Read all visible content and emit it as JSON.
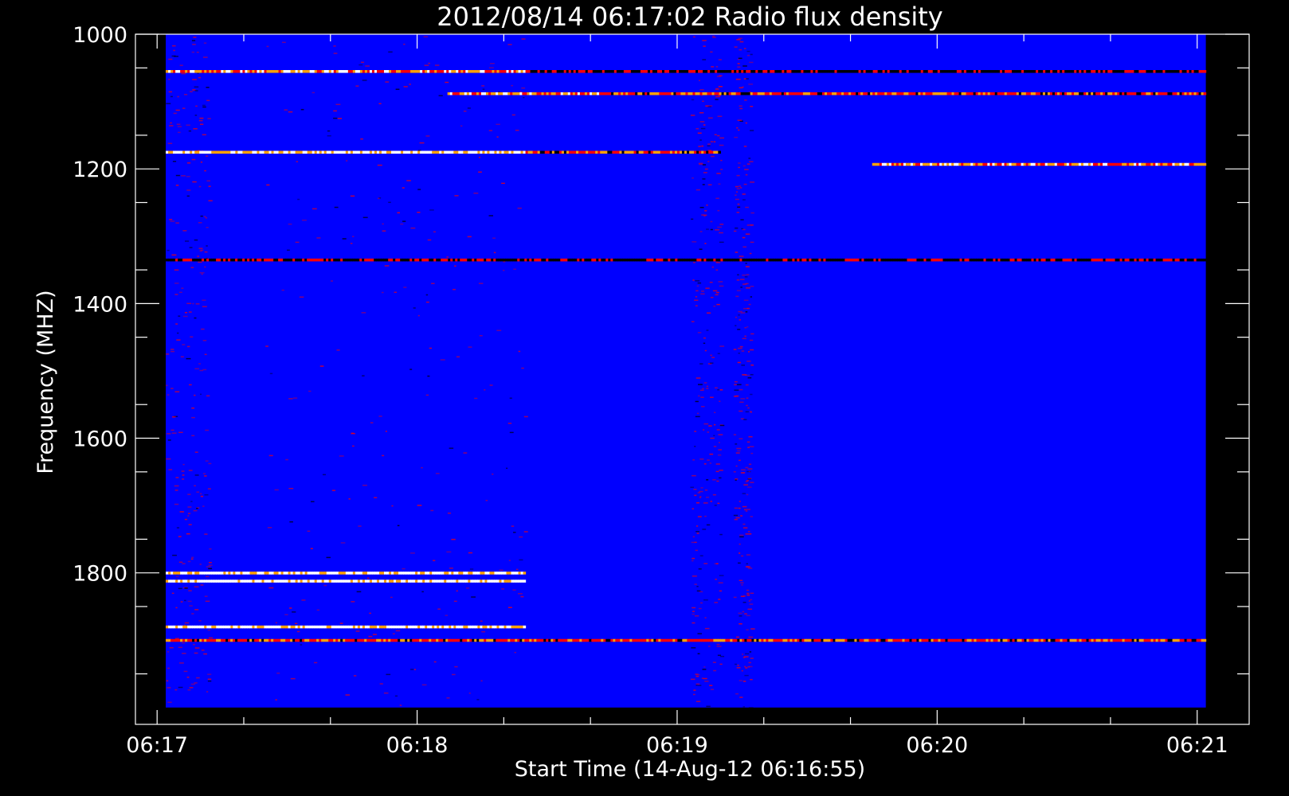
{
  "chart_data": {
    "type": "heatmap",
    "title": "2012/08/14 06:17:02 Radio flux density",
    "xlabel": "Start Time (14-Aug-12 06:16:55)",
    "ylabel": "Frequency (MHZ)",
    "x_ticks": [
      "06:17",
      "06:18",
      "06:19",
      "06:20",
      "06:21"
    ],
    "y_ticks": [
      "1000",
      "1200",
      "1400",
      "1600",
      "1800"
    ],
    "xlim": [
      "06:16:55",
      "06:21:12"
    ],
    "ylim": [
      1000,
      2025
    ],
    "y_axis_inverted": true,
    "data_extent": {
      "time_start": "06:17:02",
      "time_end": "06:21:02",
      "freq_start": 1000,
      "freq_end": 2000
    },
    "colormap": [
      "#000000",
      "#0000ff",
      "#ff0000",
      "#ffa000",
      "#ffffff"
    ],
    "background_color": "#0000ff",
    "active_periods": [
      {
        "start": "06:17:02",
        "end": "06:17:12"
      },
      {
        "start": "06:17:25",
        "end": "06:18:25"
      },
      {
        "start": "06:19:03",
        "end": "06:19:10"
      },
      {
        "start": "06:19:13",
        "end": "06:19:17"
      }
    ],
    "emission_bands": [
      {
        "freq": 1055,
        "start": "06:17:02",
        "end": "06:18:25",
        "intensity": "high"
      },
      {
        "freq": 1055,
        "start": "06:18:25",
        "end": "06:21:02",
        "intensity": "low"
      },
      {
        "freq": 1088,
        "start": "06:18:07",
        "end": "06:18:42",
        "intensity": "high"
      },
      {
        "freq": 1088,
        "start": "06:18:42",
        "end": "06:21:02",
        "intensity": "medium"
      },
      {
        "freq": 1175,
        "start": "06:17:02",
        "end": "06:18:25",
        "intensity": "very-high"
      },
      {
        "freq": 1175,
        "start": "06:18:25",
        "end": "06:19:10",
        "intensity": "medium"
      },
      {
        "freq": 1193,
        "start": "06:19:45",
        "end": "06:21:02",
        "intensity": "high"
      },
      {
        "freq": 1335,
        "start": "06:17:02",
        "end": "06:21:02",
        "intensity": "low"
      },
      {
        "freq": 1800,
        "start": "06:17:02",
        "end": "06:18:25",
        "intensity": "very-high"
      },
      {
        "freq": 1812,
        "start": "06:17:02",
        "end": "06:18:25",
        "intensity": "very-high"
      },
      {
        "freq": 1880,
        "start": "06:17:02",
        "end": "06:18:25",
        "intensity": "very-high"
      },
      {
        "freq": 1900,
        "start": "06:17:02",
        "end": "06:21:02",
        "intensity": "medium"
      }
    ]
  }
}
